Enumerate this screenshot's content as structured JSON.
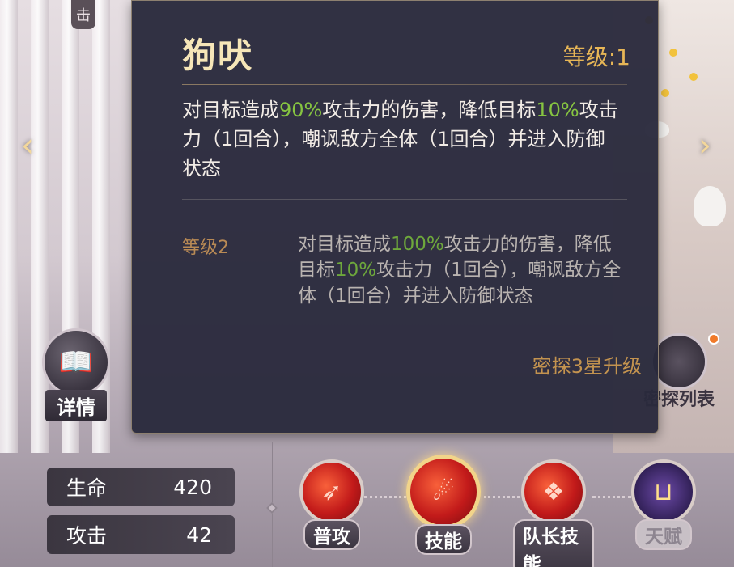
{
  "top_tab": {
    "label": "击"
  },
  "nav": {
    "prev_icon": "chevron-left-icon",
    "next_icon": "chevron-right-icon"
  },
  "skill_tooltip": {
    "name": "狗吠",
    "level": "等级:1",
    "description_parts": [
      {
        "text": "对目标造成",
        "highlight": false
      },
      {
        "text": "90%",
        "highlight": true
      },
      {
        "text": "攻击力的伤害，降低目标",
        "highlight": false
      },
      {
        "text": "10%",
        "highlight": true
      },
      {
        "text": "攻击力（1回合），嘲讽敌方全体（1回合）并进入防御状态",
        "highlight": false
      }
    ],
    "next_level_label": "等级2",
    "next_level_parts": [
      {
        "text": "对目标造成",
        "highlight": false
      },
      {
        "text": "100%",
        "highlight": true
      },
      {
        "text": "攻击力的伤害，降低目标",
        "highlight": false
      },
      {
        "text": "10%",
        "highlight": true
      },
      {
        "text": "攻击力（1回合），嘲讽敌方全体（1回合）并进入防御状态",
        "highlight": false
      }
    ],
    "upgrade_hint": "密探3星升级"
  },
  "side_buttons": {
    "details_label": "详情",
    "detective_list_label": "密探列表"
  },
  "stats": {
    "hp_label": "生命",
    "hp_value": "420",
    "atk_label": "攻击",
    "atk_value": "42"
  },
  "skill_tabs": [
    {
      "label": "普攻",
      "icon": "normal-attack-icon",
      "active": false,
      "locked": false
    },
    {
      "label": "技能",
      "icon": "skill-icon",
      "active": true,
      "locked": false
    },
    {
      "label": "队长技能",
      "icon": "leader-skill-icon",
      "active": false,
      "locked": false
    },
    {
      "label": "天赋",
      "icon": "talent-icon",
      "active": false,
      "locked": true
    }
  ],
  "colors": {
    "highlight_green": "#86c441",
    "level_gold": "#e7b656",
    "panel_bg": "#2a2a3c"
  }
}
